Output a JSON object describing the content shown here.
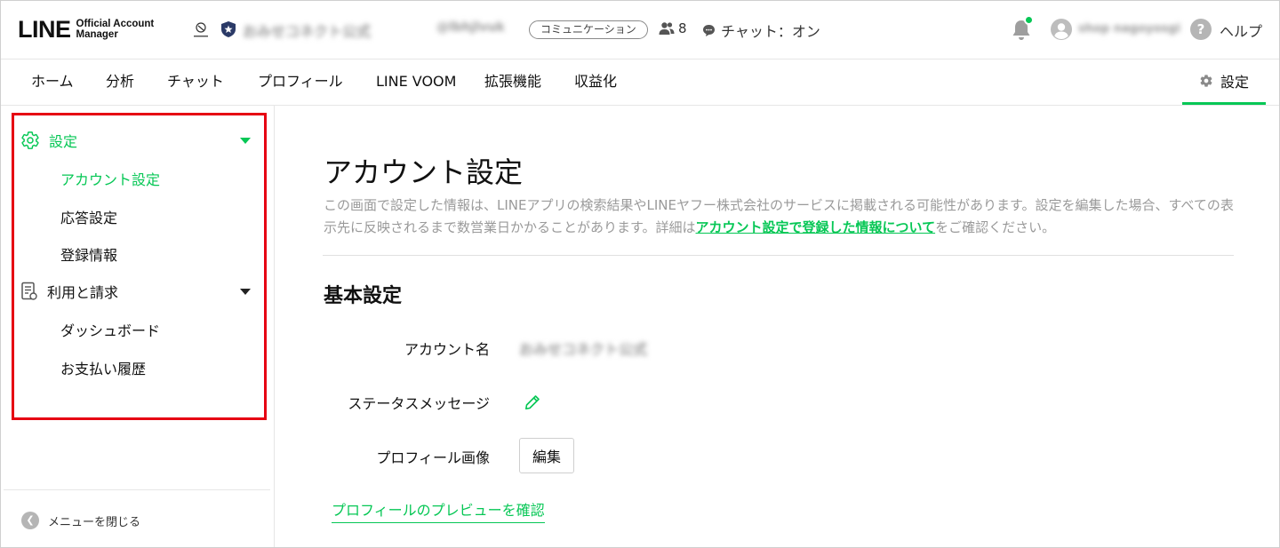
{
  "header": {
    "logo_main": "LINE",
    "logo_sub_line1": "Official Account",
    "logo_sub_line2": "Manager",
    "account_name": "おみせコネクト公式",
    "account_id": "@lbhjlvuk",
    "account_type_badge": "コミュニケーション",
    "friend_count": "8",
    "chat_status": "チャット：オン",
    "user_name": "shop nagoyosgi",
    "help_label": "ヘルプ",
    "help_icon_glyph": "?"
  },
  "nav": {
    "items": [
      {
        "label": "ホーム"
      },
      {
        "label": "分析"
      },
      {
        "label": "チャット"
      },
      {
        "label": "プロフィール"
      },
      {
        "label": "LINE VOOM"
      },
      {
        "label": "拡張機能"
      },
      {
        "label": "収益化"
      }
    ],
    "settings_label": "設定"
  },
  "sidebar": {
    "settings_section": {
      "label": "設定",
      "items": [
        {
          "label": "アカウント設定",
          "active": true
        },
        {
          "label": "応答設定"
        },
        {
          "label": "登録情報"
        }
      ]
    },
    "billing_section": {
      "label": "利用と請求",
      "items": [
        {
          "label": "ダッシュボード"
        },
        {
          "label": "お支払い履歴"
        }
      ]
    },
    "close_menu_label": "メニューを閉じる"
  },
  "main": {
    "title": "アカウント設定",
    "description_part1": "この画面で設定した情報は、LINEアプリの検索結果やLINEヤフー株式会社のサービスに掲載される可能性があります。設定を編集した場合、すべての表示先に反映されるまで数営業日かかることがあります。詳細は",
    "description_link": "アカウント設定で登録した情報について",
    "description_part2": "をご確認ください。",
    "section_title": "基本設定",
    "account_name_label": "アカウント名",
    "account_name_value": "おみせコネクト公式",
    "status_message_label": "ステータスメッセージ",
    "profile_image_label": "プロフィール画像",
    "edit_button_label": "編集",
    "preview_link": "プロフィールのプレビューを確認"
  },
  "colors": {
    "accent": "#06c755",
    "highlight_border": "#e60012",
    "muted_text": "#9a9a9a"
  }
}
